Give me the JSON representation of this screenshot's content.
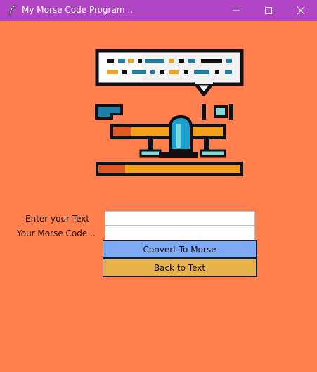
{
  "window": {
    "title": "My Morse Code Program ..",
    "controls": [
      "minimize",
      "maximize",
      "close"
    ]
  },
  "form": {
    "text_label": "Enter your Text",
    "morse_label": "Your Morse Code ..",
    "text_value": "",
    "morse_value": "",
    "convert_button": "Convert To Morse",
    "back_button": "Back to Text"
  },
  "colors": {
    "titlebar": "#b044c4",
    "background": "#ff7f4e",
    "convert_button": "#7ea9f6",
    "back_button": "#e8b24a"
  },
  "icons": {
    "app": "feather-icon",
    "illustration": "telegraph-morse-key-icon"
  }
}
